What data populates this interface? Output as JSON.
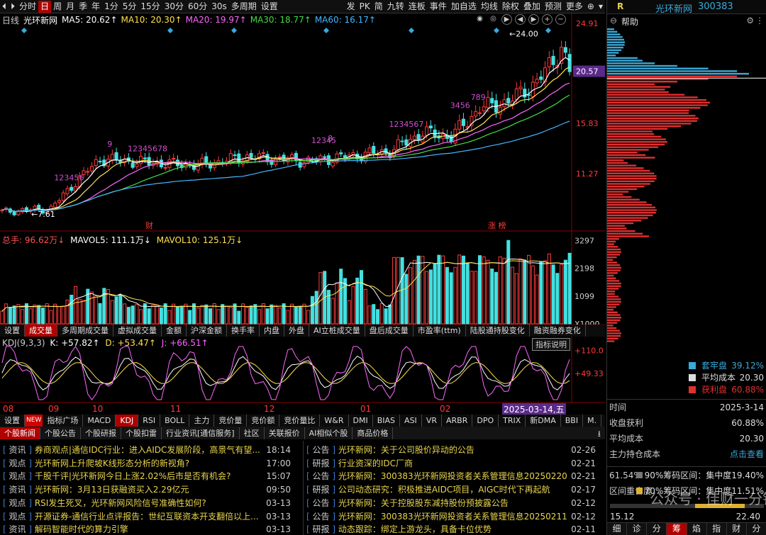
{
  "toolbar": {
    "left_buttons": [
      "分时",
      "日",
      "周",
      "月",
      "季",
      "年",
      "1分",
      "5分",
      "15分",
      "30分",
      "60分",
      "30s",
      "多周期",
      "设置"
    ],
    "active_index": 1,
    "right_buttons": [
      "发",
      "PK",
      "简",
      "九转",
      "连板",
      "事件",
      "加自选",
      "均线",
      "除权",
      "叠加",
      "预测",
      "更多"
    ]
  },
  "stock": {
    "name": "光环新网",
    "code": "300383",
    "r_label": "R",
    "help": "帮助"
  },
  "price_panel": {
    "period_label": "日线",
    "stock_name": "光环新网",
    "ma": [
      {
        "label": "MA5: 20.62↑",
        "color": "#ffffff"
      },
      {
        "label": "MA10: 20.30↑",
        "color": "#ffe24d"
      },
      {
        "label": "MA20: 19.97↑",
        "color": "#ff66ff"
      },
      {
        "label": "MA30: 18.77↑",
        "color": "#44dd44"
      },
      {
        "label": "MA60: 16.17↑",
        "color": "#44b8ff"
      }
    ],
    "axis_labels": [
      "24.91",
      "20.57",
      "15.83",
      "11.27"
    ],
    "current_price": "20.57",
    "high_mark": "24.00",
    "low_mark": "7.61",
    "markers": [
      "财",
      "涨 榜"
    ]
  },
  "volume_panel": {
    "title": "总手: 96.62万↓",
    "mavol5": "MAVOL5: 111.1万↓",
    "mavol10": "MAVOL10: 125.1万↓",
    "axis_labels": [
      "3297",
      "2198",
      "1099",
      "X1000"
    ]
  },
  "volume_tabs": [
    "设置",
    "成交量",
    "多周期成交量",
    "虚拟成交量",
    "金额",
    "沪深金额",
    "换手率",
    "内盘",
    "外盘",
    "AI立桩成交量",
    "盘后成交量",
    "市盈率(ttm)",
    "陆股通持股变化",
    "融资融券变化"
  ],
  "volume_tab_active": 1,
  "kdj_panel": {
    "title": "KDJ(9,3,3)",
    "k": "K: +57.82↑",
    "d": "D: +53.47↑",
    "j": "J: +66.51↑",
    "axis_labels": [
      "+110.0",
      "+49.33"
    ],
    "tooltip": "指标说明"
  },
  "date_axis": {
    "labels": [
      "08",
      "09",
      "10",
      "11",
      "12",
      "01",
      "02"
    ],
    "current": "2025-03-14,五"
  },
  "indicator_tabs": [
    "设置",
    "NEW",
    "指标广场",
    "MACD",
    "KDJ",
    "RSI",
    "BOLL",
    "主力",
    "竞价量",
    "竞价额",
    "竞价量比",
    "W&R",
    "DMI",
    "BIAS",
    "ASI",
    "VR",
    "ARBR",
    "DPO",
    "TRIX",
    "新DMA",
    "BBI",
    "M."
  ],
  "indicator_tab_active": 4,
  "news_tabs": [
    "个股新闻",
    "个股公告",
    "个股研报",
    "个股扣雷",
    "行业资讯[通信服务]",
    "社区",
    "关联报价",
    "AI相似个股",
    "商品价格"
  ],
  "news_tab_active": 0,
  "news_left": [
    {
      "tag": "资讯",
      "title": "券商观点|通信IDC行业：进入AIDC发展阶段，高景气有望...",
      "time": "18:14"
    },
    {
      "tag": "观点",
      "title": "光环新网上升爬坡K线形态分析的新视角?",
      "time": "17:00"
    },
    {
      "tag": "观点",
      "title": "千股千评|光环新网今日上涨2.02%后市是否有机会?",
      "time": "15:07"
    },
    {
      "tag": "资讯",
      "title": "光环新网：3月13日获融资买入2.29亿元",
      "time": "09:50"
    },
    {
      "tag": "观点",
      "title": "RSI发生死叉，光环新网风险信号准确性如何?",
      "time": "03-13"
    },
    {
      "tag": "观点",
      "title": "开源证券-通信行业点评报告：世纪互联资本开支翻倍以上...",
      "time": "03-13"
    },
    {
      "tag": "资讯",
      "title": "解码智能时代的算力引擎",
      "time": "03-13"
    }
  ],
  "news_right": [
    {
      "tag": "公告",
      "title": "光环新网：关于公司股价异动的公告",
      "time": "02-26"
    },
    {
      "tag": "研报",
      "title": "行业资深的IDC厂商",
      "time": "02-21"
    },
    {
      "tag": "公告",
      "title": "光环新网：300383光环新网投资者关系管理信息20250220",
      "time": "02-21"
    },
    {
      "tag": "研报",
      "title": "公司动态研究：积极推进AIDC项目，AIGC时代下再起航",
      "time": "02-17"
    },
    {
      "tag": "公告",
      "title": "光环新网：关于控股股东减持股份预披露公告",
      "time": "02-12"
    },
    {
      "tag": "公告",
      "title": "光环新网：300383光环新网投资者关系管理信息20250211",
      "time": "02-12"
    },
    {
      "tag": "研报",
      "title": "动态跟踪：绑定上游龙头，具备卡位优势",
      "time": "02-11"
    }
  ],
  "chip_panel": {
    "legend": [
      {
        "label": "套牢盘",
        "value": "39.12%",
        "color": "#3aa9d8"
      },
      {
        "label": "平均成本",
        "value": "20.30",
        "color": "#dddddd"
      },
      {
        "label": "获利盘",
        "value": "60.88%",
        "color": "#e03030"
      }
    ],
    "stats": [
      {
        "label": "时间",
        "value": "2025-3-14"
      },
      {
        "label": "收盘获利",
        "value": "60.88%"
      },
      {
        "label": "平均成本",
        "value": "20.30"
      },
      {
        "label": "主力持仓成本",
        "value": "点击查看"
      }
    ],
    "range90": {
      "pct": "61.54%",
      "label": "90%筹码区间：集中度19.40%"
    },
    "range70": {
      "pct": "区间重合度",
      "label": "70%筹码区间：集中度11.51%"
    },
    "axis_low": "15.12",
    "axis_high": "22.40",
    "tabs": [
      "细",
      "诊",
      "分",
      "筹",
      "焰",
      "指",
      "财",
      "分"
    ],
    "active_tab": 3,
    "watermark": "公众号 · 佳财一分钟"
  }
}
